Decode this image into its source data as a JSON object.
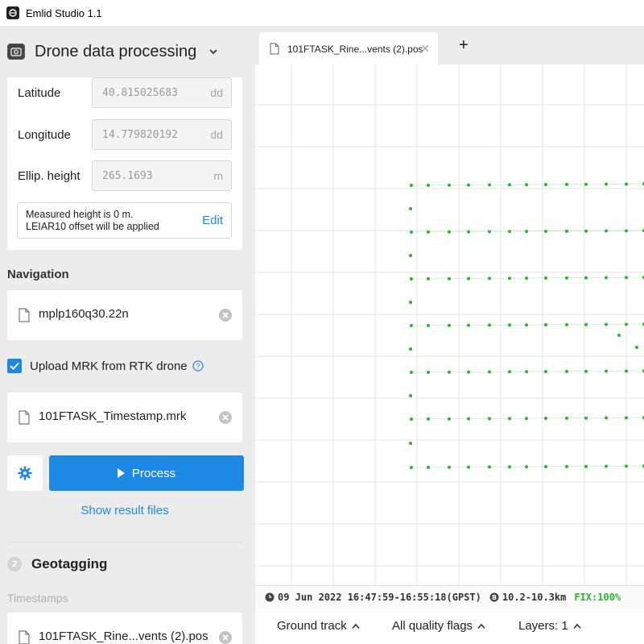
{
  "window": {
    "title": "Emlid Studio 1.1"
  },
  "panel": {
    "title": "Drone data processing"
  },
  "coords": {
    "latitude": {
      "label": "Latitude",
      "value": "40.815025683",
      "unit": "dd"
    },
    "longitude": {
      "label": "Longitude",
      "value": "14.779820192",
      "unit": "dd"
    },
    "height": {
      "label": "Ellip. height",
      "value": "265.1693",
      "unit": "m"
    }
  },
  "note": {
    "line1": "Measured height is 0 m.",
    "line2": "LEIAR10 offset will be applied",
    "edit_label": "Edit"
  },
  "navigation": {
    "label": "Navigation",
    "file": "mplp160q30.22n"
  },
  "mrk": {
    "checkbox_label": "Upload MRK from RTK drone",
    "checked": true,
    "file": "101FTASK_Timestamp.mrk"
  },
  "process": {
    "label": "Process",
    "show_results": "Show result files"
  },
  "geotagging": {
    "step": "2",
    "title": "Geotagging",
    "timestamps_label": "Timestamps",
    "file": "101FTASK_Rine...vents (2).pos"
  },
  "tabs": [
    {
      "label": "101FTASK_Rine...vents (2).pos"
    }
  ],
  "add_tab": "+",
  "status": {
    "time": "09 Jun 2022 16:47:59-16:55:18(GPST)",
    "baseline": "10.2-10.3km",
    "fix": "FIX:100%"
  },
  "bottom": {
    "ground_track": "Ground track",
    "quality_flags": "All quality flags",
    "layers": "Layers: 1"
  },
  "colors": {
    "accent": "#1e88e5",
    "track": "#2db52d",
    "grid": "#e6e6e6"
  }
}
